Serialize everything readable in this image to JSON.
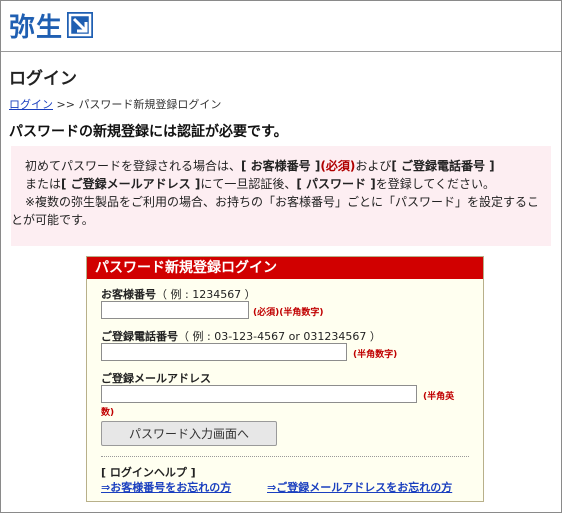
{
  "brand": {
    "name": "弥生",
    "logo_icon": "arrow-box-icon",
    "color": "#1f5fb2"
  },
  "page": {
    "title": "ログイン"
  },
  "breadcrumb": {
    "home": "ログイン",
    "separator": ">>",
    "current": "パスワード新規登録ログイン"
  },
  "notice": {
    "title": "パスワードの新規登録には認証が必要です。",
    "line1_a": "初めてパスワードを登録される場合は、",
    "line1_b": "[ お客様番号 ]",
    "line1_c": "(必須)",
    "line1_d": "および",
    "line1_e": "[ ご登録電話番号 ]",
    "line2_a": "または",
    "line2_b": "[ ご登録メールアドレス ]",
    "line2_c": "にて一旦認証後、",
    "line2_d": "[ パスワード ]",
    "line2_e": "を登録してください。",
    "line3": "※複数の弥生製品をご利用の場合、お持ちの「お客様番号」ごとに「パスワード」を設定するこ",
    "line4": "とが可能です。",
    "bg_color": "#fdeef2"
  },
  "login": {
    "header": "パスワード新規登録ログイン",
    "header_color": "#d10000",
    "customer": {
      "label": "お客様番号",
      "example": "（ 例 : 1234567 ）",
      "value": "",
      "note": "(必須)(半角数字)"
    },
    "phone": {
      "label": "ご登録電話番号",
      "example": "（ 例 : 03-123-4567 or 031234567 ）",
      "value": "",
      "note": "(半角数字)"
    },
    "email": {
      "label": "ご登録メールアドレス",
      "value": "",
      "note_a": "(半角英",
      "note_b": "数)"
    },
    "submit": "パスワード入力画面へ",
    "help_title": "[ ログインヘルプ ]",
    "help_customer": "⇒お客様番号をお忘れの方",
    "help_email": "⇒ご登録メールアドレスをお忘れの方"
  }
}
